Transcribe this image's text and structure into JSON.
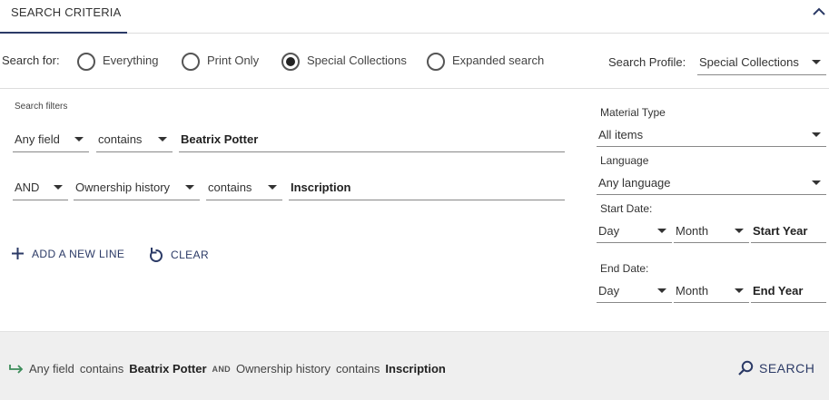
{
  "header": {
    "tab_label": "SEARCH CRITERIA"
  },
  "search_for": {
    "label": "Search for:",
    "options": [
      {
        "label": "Everything",
        "checked": false
      },
      {
        "label": "Print Only",
        "checked": false
      },
      {
        "label": "Special Collections",
        "checked": true
      },
      {
        "label": "Expanded search",
        "checked": false
      }
    ]
  },
  "profile": {
    "label": "Search Profile:",
    "value": "Special Collections"
  },
  "filters": {
    "label": "Search filters",
    "rows": [
      {
        "field": "Any field",
        "operator": "contains",
        "value": "Beatrix Potter"
      },
      {
        "boolean": "AND",
        "field": "Ownership history",
        "operator": "contains",
        "value": "Inscription"
      }
    ]
  },
  "actions": {
    "add_line": "ADD A NEW LINE",
    "clear": "CLEAR"
  },
  "right_panel": {
    "material_type": {
      "label": "Material Type",
      "value": "All items"
    },
    "language": {
      "label": "Language",
      "value": "Any language"
    },
    "start_date": {
      "label": "Start Date:",
      "day": "Day",
      "month": "Month",
      "year_placeholder": "Start Year"
    },
    "end_date": {
      "label": "End Date:",
      "day": "Day",
      "month": "Month",
      "year_placeholder": "End Year"
    }
  },
  "summary": {
    "row1_field": "Any field",
    "row1_op": "contains",
    "row1_value": "Beatrix Potter",
    "joiner": "AND",
    "row2_field": "Ownership history",
    "row2_op": "contains",
    "row2_value": "Inscription"
  },
  "search_button": "SEARCH",
  "colors": {
    "accent": "#2b3a66",
    "arrow_green": "#3c8c5a",
    "footer_bg": "#efefef"
  }
}
